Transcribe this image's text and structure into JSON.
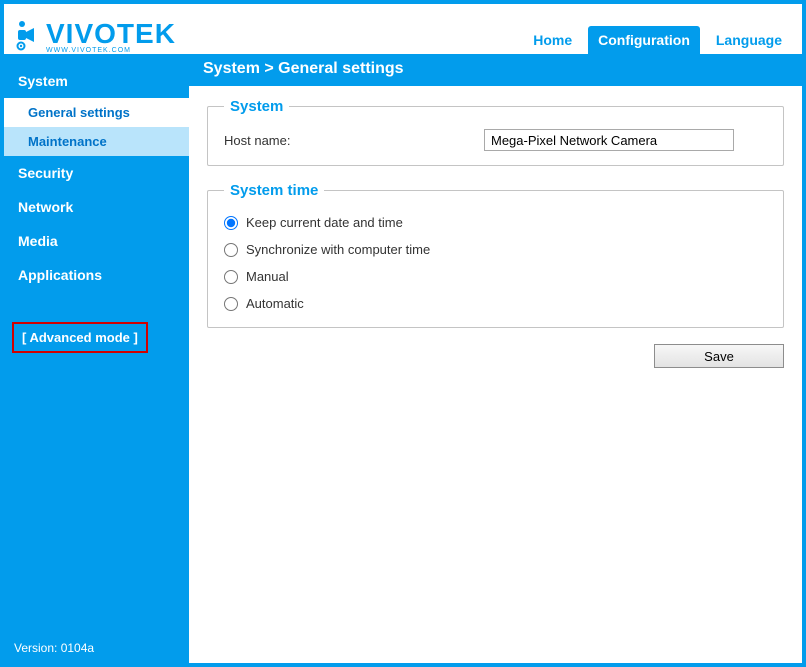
{
  "brand": {
    "name": "VIVOTEK",
    "sub": "WWW.VIVOTEK.COM"
  },
  "topnav": {
    "home": "Home",
    "configuration": "Configuration",
    "language": "Language"
  },
  "breadcrumb": "System  >  General settings",
  "sidebar": {
    "items": [
      {
        "label": "System"
      },
      {
        "label": "Security"
      },
      {
        "label": "Network"
      },
      {
        "label": "Media"
      },
      {
        "label": "Applications"
      }
    ],
    "system_sub": {
      "general": "General settings",
      "maintenance": "Maintenance"
    },
    "advanced_mode": "[ Advanced mode ]",
    "version": "Version: 0104a"
  },
  "panel": {
    "system": {
      "legend": "System",
      "hostname_label": "Host name:",
      "hostname_value": "Mega-Pixel Network Camera"
    },
    "systemtime": {
      "legend": "System time",
      "options": {
        "keep": "Keep current date and time",
        "sync": "Synchronize with computer time",
        "manual": "Manual",
        "auto": "Automatic"
      }
    },
    "save": "Save"
  }
}
